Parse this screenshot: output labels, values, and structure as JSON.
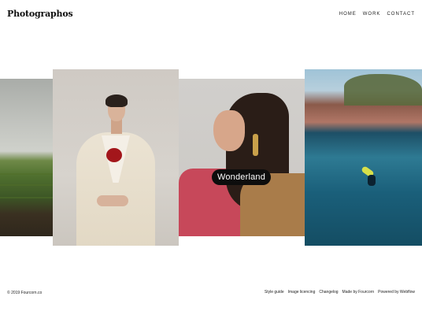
{
  "brand": {
    "logo": "Photographos"
  },
  "nav": {
    "items": [
      {
        "label": "HOME"
      },
      {
        "label": "WORK"
      },
      {
        "label": "CONTACT"
      }
    ]
  },
  "gallery": {
    "caption": "Wonderland"
  },
  "footer": {
    "copyright": "© 2019 Fourcorn.co",
    "links": [
      {
        "label": "Style guide"
      },
      {
        "label": "Image licencing"
      },
      {
        "label": "Changelog"
      },
      {
        "label": "Made by Fourcorn"
      },
      {
        "label": "Powered by Webflow"
      }
    ]
  },
  "colors": {
    "background": "#ffffff",
    "caption_background": "#0d0d0d",
    "caption_text": "#ffffff",
    "text": "#111111"
  }
}
